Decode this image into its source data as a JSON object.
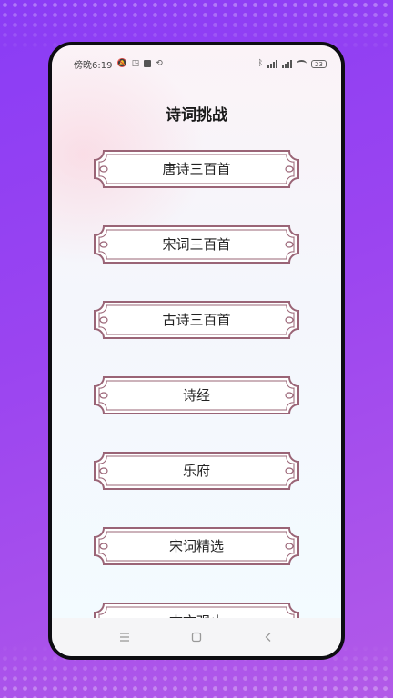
{
  "status_bar": {
    "time": "傍晚6:19",
    "network_1": "4G",
    "network_2": "4G",
    "battery": "23"
  },
  "page": {
    "title": "诗词挑战"
  },
  "menu_items": [
    {
      "label": "唐诗三百首"
    },
    {
      "label": "宋词三百首"
    },
    {
      "label": "古诗三百首"
    },
    {
      "label": "诗经"
    },
    {
      "label": "乐府"
    },
    {
      "label": "宋词精选"
    },
    {
      "label": "古文观止"
    }
  ],
  "colors": {
    "plaque_border": "#9a6476",
    "plaque_fill": "#ffffff",
    "phone_bezel": "#0d0d12",
    "background_purple": "#8a3cf5"
  }
}
